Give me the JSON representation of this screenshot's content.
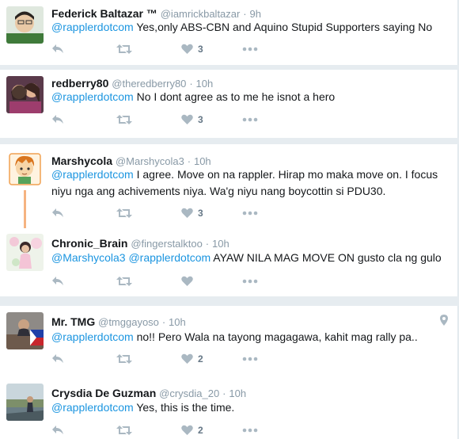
{
  "tweets": [
    {
      "name": "Federick Baltazar ™",
      "handle": "@iamrickbaltazar",
      "dot": "·",
      "time": "9h",
      "mention": "@rapplerdotcom",
      "text": " Yes,only ABS-CBN and Aquino Stupid Supporters saying No",
      "likes": "3"
    },
    {
      "name": "redberry80",
      "handle": "@theredberry80",
      "dot": "·",
      "time": "10h",
      "mention": "@rapplerdotcom",
      "text": " No I dont agree as to me he isnot a hero",
      "likes": "3"
    },
    {
      "name": "Marshycola",
      "handle": "@Marshycola3",
      "dot": "·",
      "time": "10h",
      "mention": "@rapplerdotcom",
      "text": " I agree. Move on na rappler. Hirap mo maka move on. I focus niyu nga ang achivements niya. Wa'g niyu nang boycottin si PDU30.",
      "likes": "3"
    },
    {
      "name": "Chronic_Brain",
      "handle": "@fingerstalktoo",
      "dot": "·",
      "time": "10h",
      "mention": "@Marshycola3 @rapplerdotcom",
      "text": " AYAW NILA MAG MOVE ON gusto cla ng gulo",
      "likes": ""
    },
    {
      "name": "Mr. TMG",
      "handle": "@tmggayoso",
      "dot": "·",
      "time": "10h",
      "mention": "@rapplerdotcom",
      "text": " no!! Pero Wala na tayong magagawa, kahit mag rally pa..",
      "likes": "2"
    },
    {
      "name": "Crysdia De Guzman",
      "handle": "@crysdia_20",
      "dot": "·",
      "time": "10h",
      "mention": "@rapplerdotcom",
      "text": " Yes, this is the time.",
      "likes": "2"
    }
  ],
  "colors": {
    "link": "#1b95e0",
    "muted": "#8899a6",
    "icon": "#aab8c2",
    "thread_line": "#f5b381"
  },
  "icons": [
    "reply-icon",
    "retweet-icon",
    "heart-icon",
    "more-icon",
    "location-pin-icon"
  ]
}
